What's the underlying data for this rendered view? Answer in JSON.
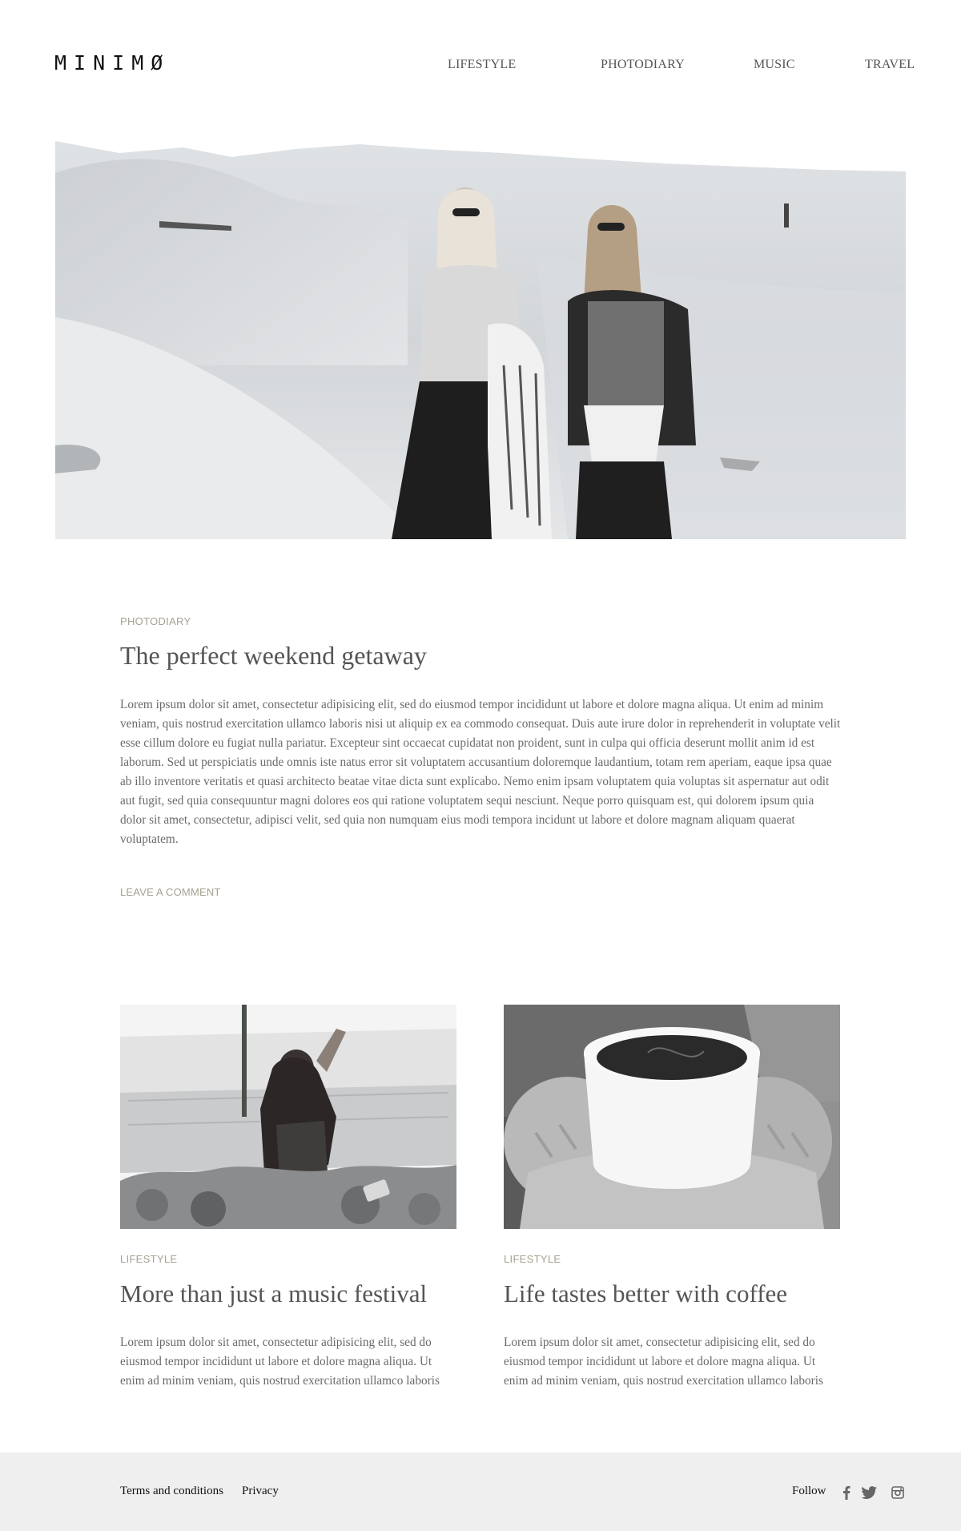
{
  "header": {
    "logo": "MINIMØ",
    "nav": [
      {
        "label": "LIFESTYLE"
      },
      {
        "label": "PHOTODIARY"
      },
      {
        "label": "MUSIC"
      },
      {
        "label": "TRAVEL"
      }
    ]
  },
  "featured": {
    "category": "PHOTODIARY",
    "title": "The perfect weekend getaway",
    "body": "Lorem ipsum dolor sit amet, consectetur adipisicing elit, sed do eiusmod tempor incididunt ut labore et dolore magna aliqua. Ut enim ad minim veniam, quis nostrud exercitation ullamco laboris nisi ut aliquip ex ea commodo consequat. Duis aute irure dolor in reprehenderit in voluptate velit esse cillum dolore eu fugiat nulla pariatur. Excepteur sint occaecat cupidatat non proident, sunt in culpa qui officia deserunt mollit anim id est laborum. Sed ut perspiciatis unde omnis iste natus error sit voluptatem accusantium doloremque laudantium, totam rem aperiam, eaque ipsa quae ab illo inventore veritatis et quasi architecto beatae vitae dicta sunt explicabo. Nemo enim ipsam voluptatem quia voluptas sit aspernatur aut odit aut fugit, sed quia consequuntur magni dolores eos qui ratione voluptatem sequi nesciunt. Neque porro quisquam est, qui dolorem ipsum quia dolor sit amet, consectetur, adipisci velit, sed quia non numquam eius modi tempora incidunt ut labore et dolore magnam aliquam quaerat voluptatem.",
    "comment_link": "LEAVE A COMMENT"
  },
  "cards": [
    {
      "category": "LIFESTYLE",
      "title": "More than just a music festival",
      "excerpt": "Lorem ipsum dolor sit amet, consectetur adipisicing elit, sed do eiusmod tempor incididunt ut labore et dolore magna aliqua. Ut enim ad minim veniam, quis nostrud exercitation ullamco laboris"
    },
    {
      "category": "LIFESTYLE",
      "title": "Life tastes better with coffee",
      "excerpt": "Lorem ipsum dolor sit amet, consectetur adipisicing elit, sed do eiusmod tempor incididunt ut labore et dolore magna aliqua. Ut enim ad minim veniam, quis nostrud exercitation ullamco laboris"
    }
  ],
  "footer": {
    "links": [
      {
        "label": "Terms and conditions"
      },
      {
        "label": "Privacy"
      }
    ],
    "follow_label": "Follow",
    "social_icons": [
      "facebook-icon",
      "twitter-icon",
      "instagram-icon"
    ]
  },
  "colors": {
    "accent_category": "#a6a08f",
    "footer_background": "#efefef",
    "heading": "#555555",
    "body_text": "#6a6a6a"
  }
}
